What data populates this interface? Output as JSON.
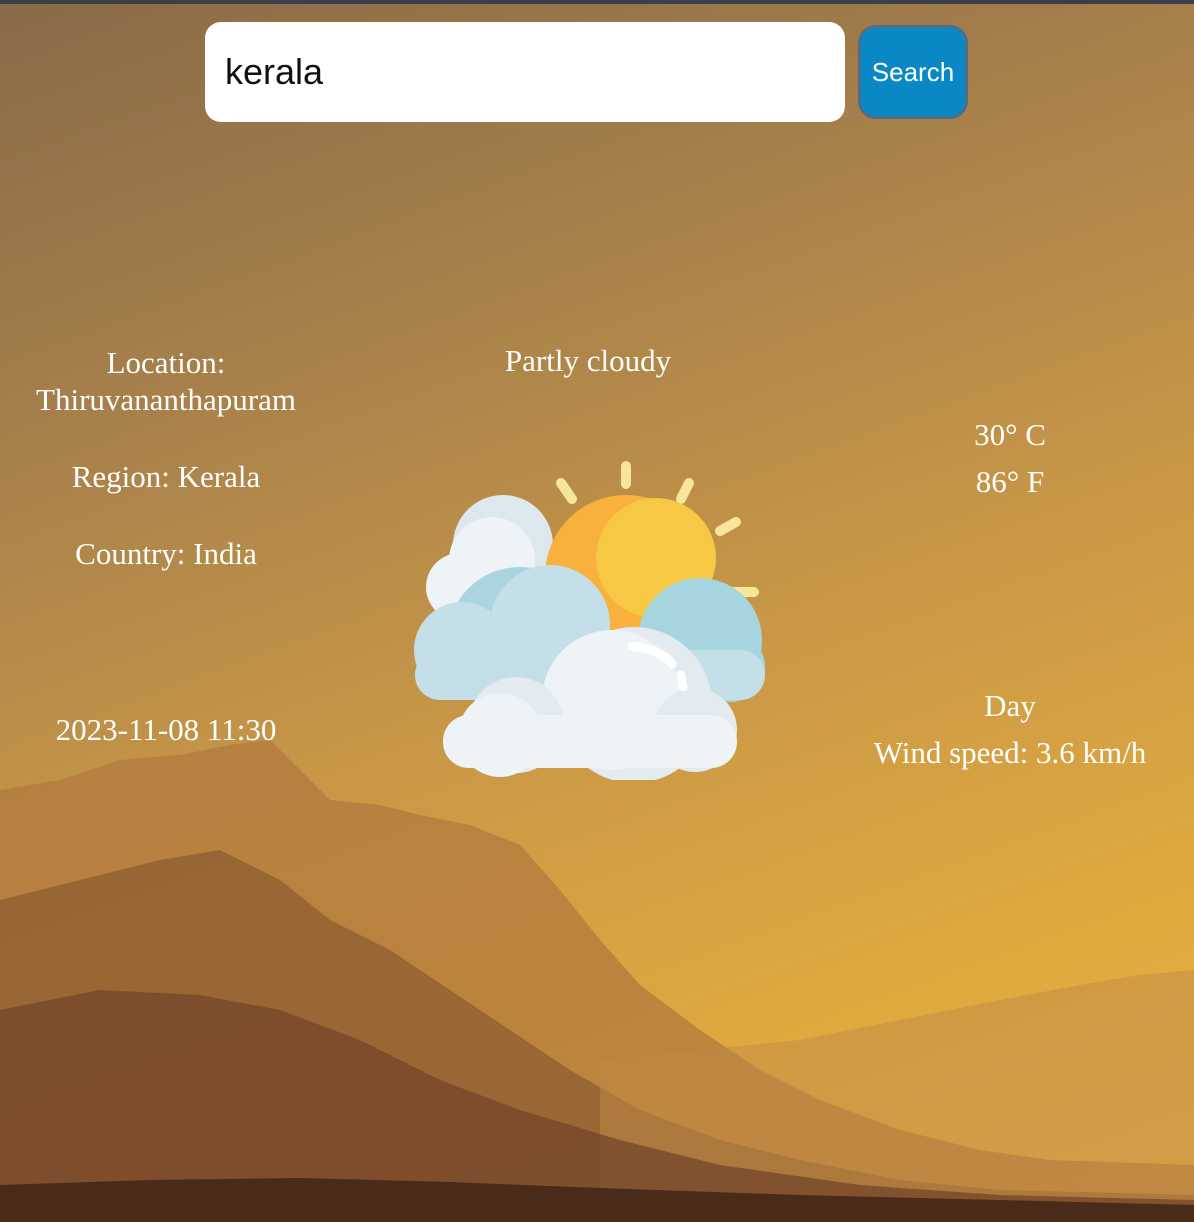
{
  "search": {
    "value": "kerala",
    "button_label": "Search"
  },
  "location": {
    "label": "Location:",
    "value": "Thiruvananthapuram"
  },
  "region": "Region: Kerala",
  "country": "Country: India",
  "localtime": "2023-11-08 11:30",
  "condition": {
    "text": "Partly cloudy",
    "icon": "partly-cloudy-icon"
  },
  "temperature": {
    "celsius": "30° C",
    "fahrenheit": "86° F"
  },
  "day_night": "Day",
  "wind": "Wind speed: 3.6 km/h",
  "colors": {
    "search_button": "#0a88c6",
    "text": "#ffffff",
    "sun": "#f8b13c",
    "cloud": "#eef3f7"
  }
}
